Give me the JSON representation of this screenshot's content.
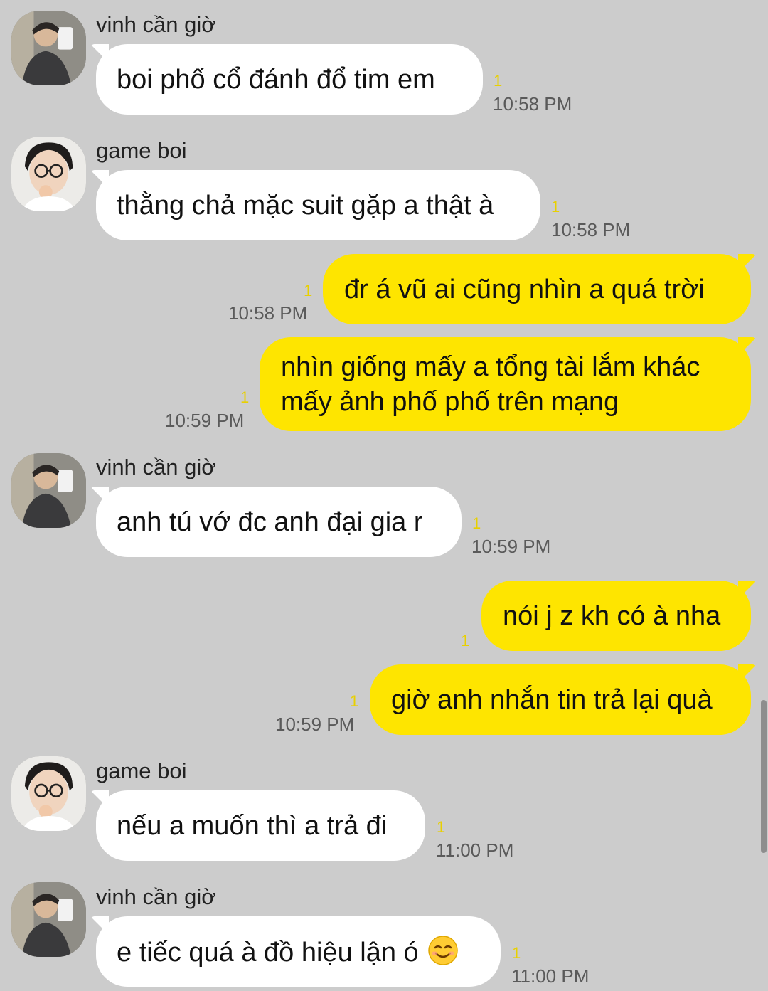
{
  "users": {
    "vinh": {
      "name": "vinh cần giờ"
    },
    "game": {
      "name": "game boi"
    }
  },
  "messages": [
    {
      "from": "vinh",
      "text": "boi phố cổ đánh đổ tim em",
      "unread": "1",
      "time": "10:58 PM"
    },
    {
      "from": "game",
      "text": "thằng chả mặc suit gặp a thật à",
      "unread": "1",
      "time": "10:58 PM"
    },
    {
      "from": "me",
      "text": "đr á vũ ai cũng nhìn a quá trời",
      "unread": "1",
      "time": "10:58 PM"
    },
    {
      "from": "me",
      "text_line1": "nhìn giống mấy a tổng tài lắm khác",
      "text_line2": "mấy ảnh phố phố trên mạng",
      "unread": "1",
      "time": "10:59 PM"
    },
    {
      "from": "vinh",
      "text": "anh tú vớ đc anh đại gia r",
      "unread": "1",
      "time": "10:59 PM"
    },
    {
      "from": "me",
      "text": "nói j z kh có à nha",
      "unread": "1",
      "time": ""
    },
    {
      "from": "me",
      "text": "giờ anh nhắn tin trả lại quà",
      "unread": "1",
      "time": "10:59 PM"
    },
    {
      "from": "game",
      "text": "nếu a muốn thì a trả đi",
      "unread": "1",
      "time": "11:00 PM"
    },
    {
      "from": "vinh",
      "text": "e tiếc quá à đồ hiệu lận ó",
      "emoji": "smiling-face-icon",
      "unread": "1",
      "time": "11:00 PM"
    }
  ],
  "colors": {
    "background": "#cccccc",
    "incoming_bubble": "#ffffff",
    "outgoing_bubble": "#fee500",
    "unread_count": "#e8d000",
    "timestamp": "#5a5a5a"
  }
}
